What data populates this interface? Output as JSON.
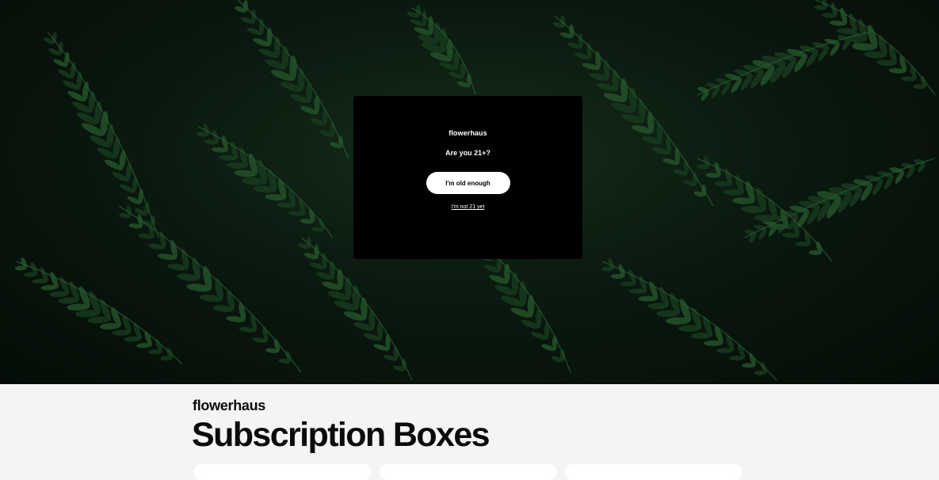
{
  "modal": {
    "brand": "flowerhaus",
    "question": "Are you 21+?",
    "confirm_label": "I'm old enough",
    "decline_label": "I'm not 21 yet"
  },
  "header": {
    "brand": "flowerhaus"
  },
  "main": {
    "title": "Subscription Boxes"
  },
  "colors": {
    "modal_background": "#000000",
    "page_background": "#f4f4f4",
    "fern_green": "#1f4a26"
  }
}
